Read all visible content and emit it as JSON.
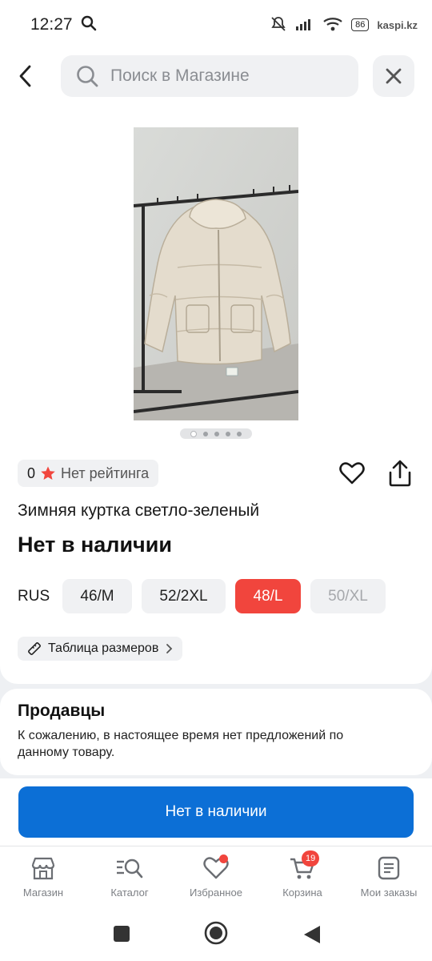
{
  "status_bar": {
    "time": "12:27",
    "battery": "86",
    "watermark": "kaspi.kz"
  },
  "search": {
    "placeholder": "Поиск в Магазине"
  },
  "product": {
    "rating_value": "0",
    "rating_text": "Нет рейтинга",
    "title": "Зимняя куртка светло-зеленый",
    "availability": "Нет в наличии",
    "image_count": 5,
    "active_image": 1,
    "sizes_label": "RUS",
    "sizes": [
      {
        "label": "46/M",
        "state": "normal"
      },
      {
        "label": "52/2XL",
        "state": "normal"
      },
      {
        "label": "48/L",
        "state": "selected"
      },
      {
        "label": "50/XL",
        "state": "disabled"
      }
    ],
    "size_table_label": "Таблица размеров"
  },
  "sellers": {
    "title": "Продавцы",
    "text": "К сожалению, в настоящее время нет предложений по данному товару."
  },
  "cta": {
    "label": "Нет в наличии"
  },
  "bottom_nav": {
    "items": [
      {
        "label": "Магазин",
        "icon": "store-icon"
      },
      {
        "label": "Каталог",
        "icon": "catalog-search-icon"
      },
      {
        "label": "Избранное",
        "icon": "heart-icon"
      },
      {
        "label": "Корзина",
        "icon": "cart-icon"
      },
      {
        "label": "Мои заказы",
        "icon": "orders-icon"
      }
    ],
    "cart_badge": "19"
  },
  "colors": {
    "accent_blue": "#0c6fd6",
    "accent_red": "#f1453d"
  }
}
